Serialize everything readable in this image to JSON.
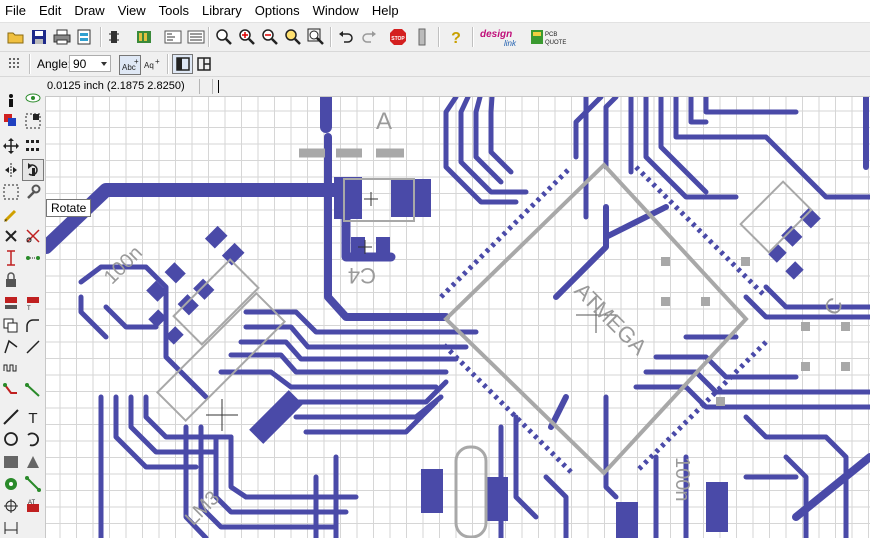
{
  "menu": [
    "File",
    "Edit",
    "Draw",
    "View",
    "Tools",
    "Library",
    "Options",
    "Window",
    "Help"
  ],
  "toolbar": {
    "angle_label": "Angle:",
    "angle_value": "90",
    "designlink_logo": "design link",
    "pcbquote_logo": "PCB QUOTE"
  },
  "status": {
    "coordinates": "0.0125 inch (2.1875 2.8250)"
  },
  "tooltip": "Rotate",
  "pcb": {
    "silk_labels": {
      "c4": "C4",
      "atmega": "ATMEGA",
      "atmega_partno": "ATMEGA",
      "lm3": "LM3",
      "cap_100n_a": "100n",
      "cap_100n_b": "100n",
      "fragment_a": "A",
      "fragment_c": "C"
    },
    "colors": {
      "trace": "#4a4aa8",
      "silk": "#a8a8a8",
      "grid": "#d6d6d6"
    }
  }
}
